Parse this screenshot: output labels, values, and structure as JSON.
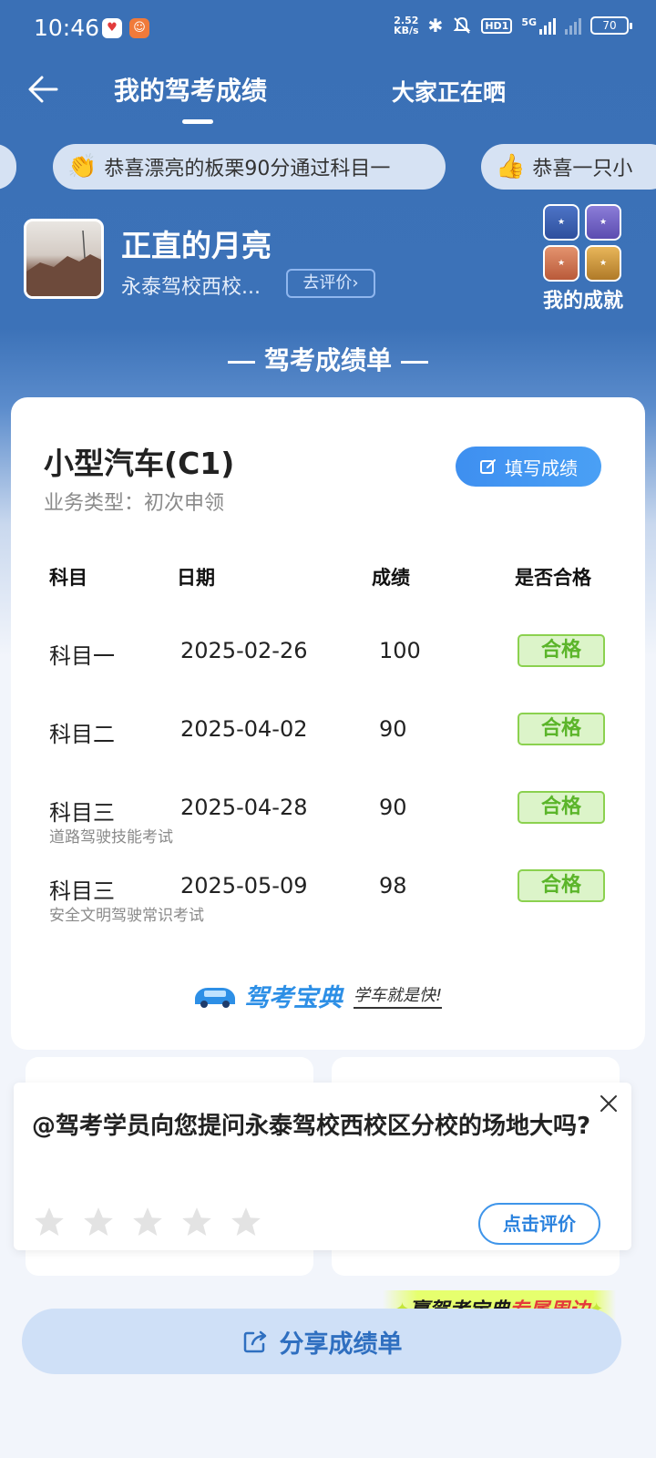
{
  "status_bar": {
    "time": "10:46",
    "net_speed": "2.52",
    "net_unit": "KB/s",
    "hd_label": "HD1",
    "network": "5G",
    "battery": "70"
  },
  "header": {
    "tab_mine": "我的驾考成绩",
    "tab_everyone": "大家正在晒"
  },
  "ticker": {
    "items": [
      {
        "emoji": "👏",
        "text": "恭喜漂亮的板栗90分通过科目一"
      },
      {
        "emoji": "👍",
        "text": "恭喜一只小"
      }
    ]
  },
  "profile": {
    "name": "正直的月亮",
    "school": "永泰驾校西校...",
    "review_button": "去评价",
    "achievements_label": "我的成就"
  },
  "section_title": "驾考成绩单",
  "card": {
    "license": "小型汽车(C1)",
    "business_type": "业务类型：初次申领",
    "fill_button": "填写成绩",
    "headers": {
      "subject": "科目",
      "date": "日期",
      "score": "成绩",
      "passed": "是否合格"
    },
    "rows": [
      {
        "subject": "科目一",
        "date": "2025-02-26",
        "score": "100",
        "status": "合格",
        "note": ""
      },
      {
        "subject": "科目二",
        "date": "2025-04-02",
        "score": "90",
        "status": "合格",
        "note": ""
      },
      {
        "subject": "科目三",
        "date": "2025-04-28",
        "score": "90",
        "status": "合格",
        "note": "道路驾驶技能考试"
      },
      {
        "subject": "科目三",
        "date": "2025-05-09",
        "score": "98",
        "status": "合格",
        "note": "安全文明驾驶常识考试"
      }
    ],
    "brand_name": "驾考宝典",
    "brand_slogan": "学车就是快!"
  },
  "popup": {
    "question": "@驾考学员向您提问永泰驾校西校区分校的场地大吗?",
    "rate_button": "点击评价",
    "stars_total": 5,
    "stars_filled": 0
  },
  "promo": {
    "part1": "赢驾考宝典",
    "part2": "专属周边"
  },
  "share_button": "分享成绩单",
  "colors": {
    "header_blue": "#3a70b6",
    "accent_blue": "#3e8ff0",
    "pass_green": "#5bb52a",
    "pass_bg": "#dcf4c9"
  }
}
